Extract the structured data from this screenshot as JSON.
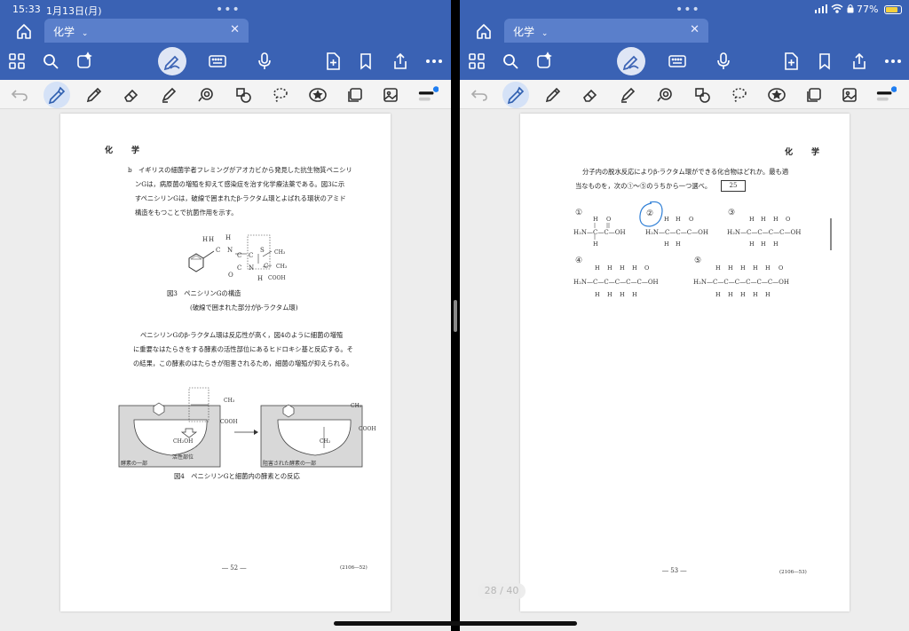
{
  "status_bar": {
    "time": "15:33",
    "date": "1月13日(月)",
    "battery_percent": "77%"
  },
  "left_pane": {
    "tab_title": "化学",
    "page": {
      "header": "化　学",
      "para_b": [
        "b　イギリスの細菌学者フレミングがアオカビから発見した抗生物質ペニシリ",
        "ンGは，病原菌の増殖を抑えて感染症を治す化学療法薬である。図3に示",
        "すペニシリンGは，破線で囲まれたβ-ラクタム環とよばれる環状のアミド",
        "構造をもつことで抗菌作用を示す。"
      ],
      "fig3_caption": "図3　ペニシリンGの構造",
      "fig3_note": "(破線で囲まれた部分がβ-ラクタム環)",
      "para2": [
        "ペニシリンGのβ-ラクタム環は反応性が高く，図4のように細菌の増殖",
        "に重要なはたらきをする酵素の活性部位にあるヒドロキシ基と反応する。そ",
        "の結果，この酵素のはたらきが阻害されるため，細菌の増殖が抑えられる。"
      ],
      "fig3_labels": [
        "H",
        "H",
        "H",
        "C",
        "N",
        "C",
        "C",
        "S",
        "CH₃",
        "CH₃",
        "O",
        "C",
        "N",
        "C",
        "H",
        "COOH"
      ],
      "fig4_labels": {
        "ch2oh": "CH₂OH",
        "active_site": "活性部位",
        "enzyme_part": "酵素の一部",
        "inhibited": "阻害された酵素の一部",
        "cooh": "COOH",
        "ch2": "CH₂",
        "ch3": "CH₃"
      },
      "fig4_caption": "図4　ペニシリンGと細菌内の酵素との反応",
      "page_number": "― 52 ―",
      "code": "(2106―52)"
    }
  },
  "right_pane": {
    "tab_title": "化学",
    "page": {
      "header": "化　学",
      "question_line1": "分子内の脱水反応によりβ-ラクタム環ができる化合物はどれか。最も適",
      "question_line2": "当なものを，次の①～⑤のうちから一つ選べ。",
      "answer_box": "25",
      "options": [
        {
          "num": "①",
          "formula": "H₂N—C—C—OH"
        },
        {
          "num": "②",
          "formula": "H₂N—C—C—C—OH"
        },
        {
          "num": "③",
          "formula": "H₂N—C—C—C—C—OH"
        },
        {
          "num": "④",
          "formula": "H₂N—C—C—C—C—C—OH"
        },
        {
          "num": "⑤",
          "formula": "H₂N—C—C—C—C—C—C—OH"
        }
      ],
      "page_number": "― 53 ―",
      "code": "(2106―53)"
    }
  },
  "page_counter": "28 / 40",
  "colors": {
    "toolbar_blue": "#3a62b4",
    "tab_blue": "#5a7fcb",
    "ink_annotation": "#2f7fd6"
  }
}
